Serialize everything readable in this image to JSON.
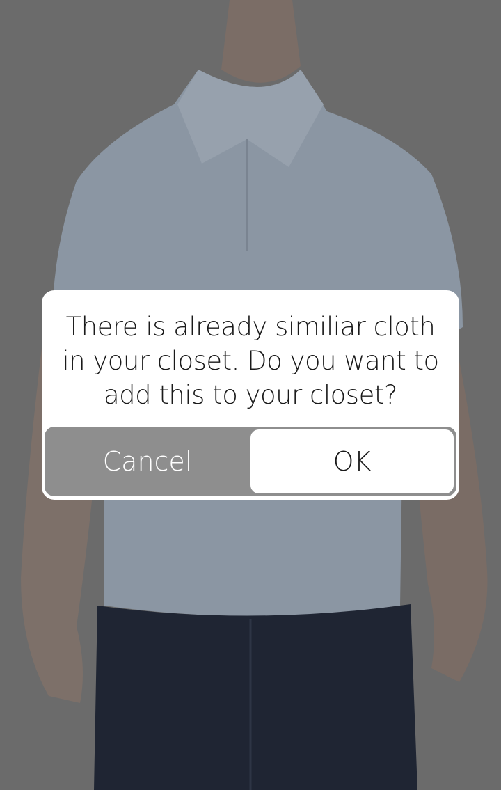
{
  "background": {
    "overlay_color": "#6b6b6b",
    "shirt_color": "#8b96a3",
    "jeans_color": "#1f2533",
    "skin_color": "#7d7068"
  },
  "dialog": {
    "message": "There is already similiar cloth in your closet. Do you want to add this to your closet?",
    "cancel_label": "Cancel",
    "ok_label": "OK",
    "button_bar_color": "#8e8e8e"
  }
}
